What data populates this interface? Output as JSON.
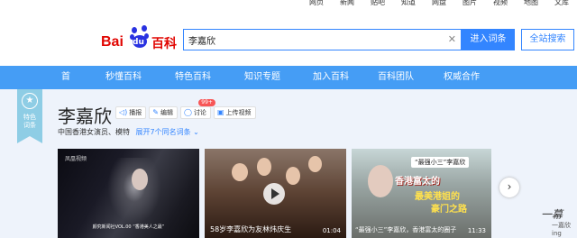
{
  "topnav": [
    "网页",
    "新闻",
    "贴吧",
    "知道",
    "网盘",
    "图片",
    "视频",
    "地图",
    "文库"
  ],
  "logo": {
    "bai": "Bai",
    "du": "du",
    "baike": "百科"
  },
  "search": {
    "value": "李嘉欣",
    "enter_label": "进入词条",
    "site_label": "全站搜索"
  },
  "navbar": [
    "首页",
    "秒懂百科",
    "特色百科",
    "知识专题",
    "加入百科",
    "百科团队",
    "权威合作"
  ],
  "badge": {
    "line1": "特色",
    "line2": "词条"
  },
  "entry": {
    "title": "李嘉欣",
    "subtitle": "中国香港女演员、模特",
    "same_name_link": "展开7个同名词条 ⌄"
  },
  "actions": [
    {
      "icon": "speaker-icon",
      "label": "播报"
    },
    {
      "icon": "pencil-icon",
      "label": "编辑"
    },
    {
      "icon": "comment-icon",
      "label": "讨论",
      "badge": "99+"
    },
    {
      "icon": "upload-video-icon",
      "label": "上传视频"
    }
  ],
  "media": {
    "m1": {
      "logo": "凤凰视频",
      "caption": "颜究新闻社VOL.00 “香港美人之最”"
    },
    "m2": {
      "caption": "58岁李嘉欣为友林炜庆生",
      "duration": "01:04"
    },
    "m3": {
      "tag": "“最强小三”李嘉欣",
      "headline1": "香港富太的",
      "headline2": "最美港姐的",
      "headline3": "豪门之路",
      "caption": "“最强小三”李嘉欣，香港富太的圈子",
      "duration": "11:33"
    }
  },
  "side_text": {
    "sign": "一幕",
    "small": "一嘉欣ing"
  },
  "colors": {
    "accent": "#3385ff",
    "navbar": "#459df5",
    "brand_red": "#e10602",
    "badge": "#8ecde5"
  }
}
